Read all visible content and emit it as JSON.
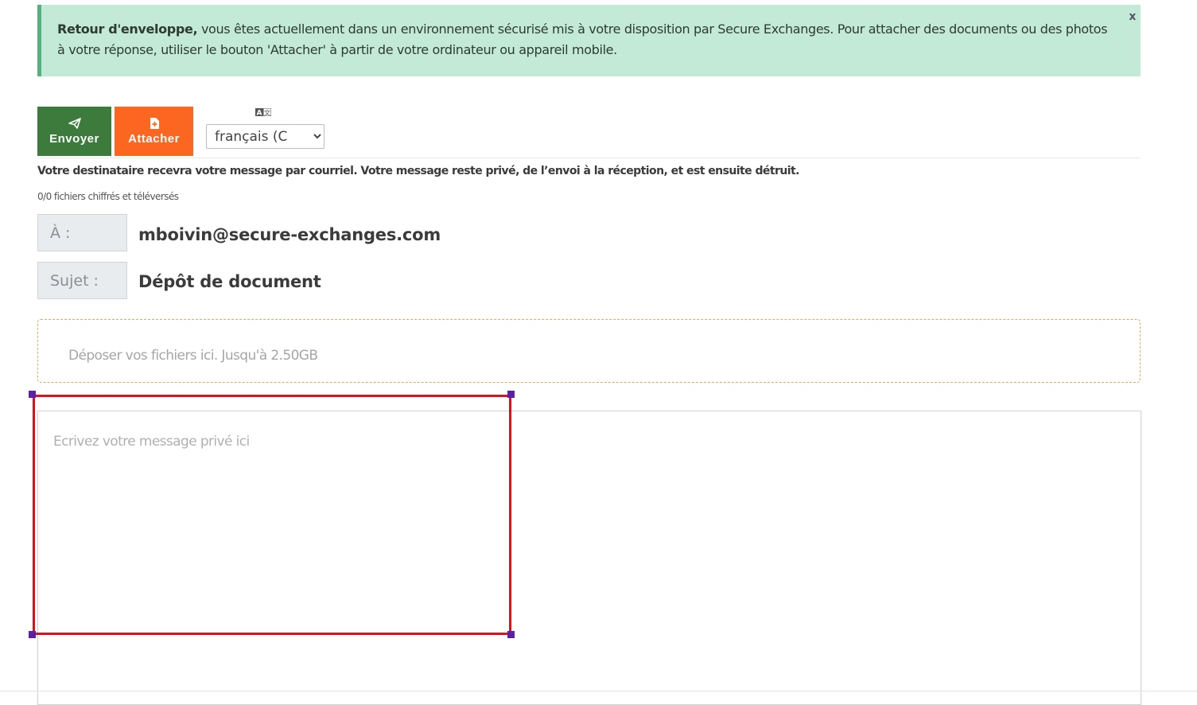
{
  "alert": {
    "bold": "Retour d'enveloppe,",
    "text": " vous êtes actuellement dans un environnement sécurisé mis à votre disposition par Secure Exchanges. Pour attacher des documents ou des photos à votre réponse, utiliser le bouton 'Attacher' à partir de votre ordinateur ou appareil mobile.",
    "close": "x",
    "colors": {
      "background": "#c3ead6",
      "border": "#52b27e"
    }
  },
  "toolbar": {
    "send_label": "Envoyer",
    "send_icon": "paper-plane-icon",
    "attach_label": "Attacher",
    "attach_icon": "file-plus-icon",
    "language_icon": "translate-icon",
    "language_selected": "français (C",
    "colors": {
      "send": "#3d7b3c",
      "attach": "#fb6620"
    }
  },
  "notice": "Votre destinataire recevra votre message par courriel. Votre message reste privé, de l’envoi à la réception, et est ensuite détruit.",
  "counter": "0/0 fichiers chiffrés et téléversés",
  "fields": {
    "to_label": "À :",
    "to_value": "mboivin@secure-exchanges.com",
    "subject_label": "Sujet :",
    "subject_value": "Dépôt de document"
  },
  "dropzone": {
    "text": "Déposer vos fichiers ici. Jusqu'à 2.50GB"
  },
  "editor": {
    "placeholder": "Ecrivez votre message privé ici"
  }
}
